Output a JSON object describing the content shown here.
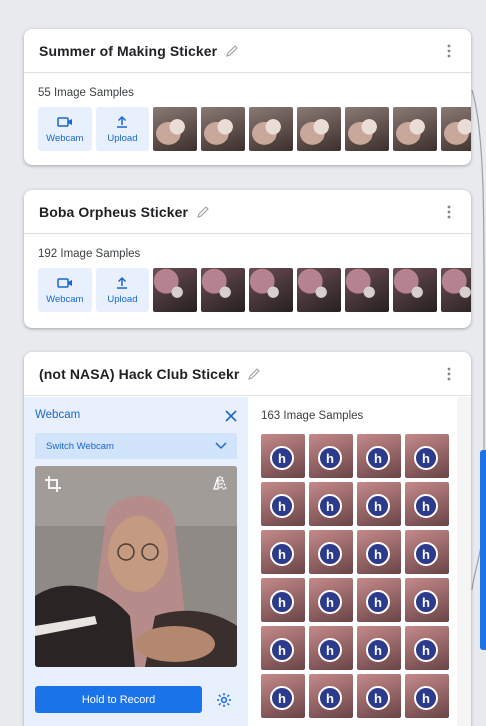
{
  "classes": [
    {
      "title": "Summer of Making Sticker",
      "samples_label": "55 Image Samples",
      "webcam_label": "Webcam",
      "upload_label": "Upload",
      "thumb_style": "hand"
    },
    {
      "title": "Boba Orpheus Sticker",
      "samples_label": "192 Image Samples",
      "webcam_label": "Webcam",
      "upload_label": "Upload",
      "thumb_style": "boba"
    }
  ],
  "active_class": {
    "title": "(not NASA) Hack Club Sticekr",
    "samples_label": "163 Image Samples",
    "webcam": {
      "title": "Webcam",
      "switch_label": "Switch Webcam",
      "record_label": "Hold to Record"
    },
    "thumb_count": 24
  },
  "icons": {
    "edit": "pencil-icon",
    "menu": "kebab-menu-icon",
    "webcam": "video-camera-icon",
    "upload": "upload-icon",
    "close": "close-icon",
    "dropdown": "chevron-down-icon",
    "crop": "crop-icon",
    "flip": "flip-icon",
    "settings": "gear-icon"
  },
  "colors": {
    "accent": "#1a73e8",
    "accent_text": "#1967d2",
    "accent_bg": "#e8f0fe",
    "page_bg": "#e8eaed"
  }
}
